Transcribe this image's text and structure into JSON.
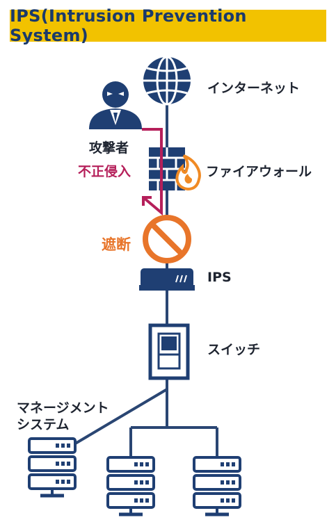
{
  "title": "IPS(Intrusion Prevention System)",
  "labels": {
    "internet": "インターネット",
    "attacker": "攻撃者",
    "intrusion": "不正侵入",
    "firewall": "ファイアウォール",
    "block": "遮断",
    "ips": "IPS",
    "switch": "スイッチ",
    "management_line1": "マネージメント",
    "management_line2": "システム"
  },
  "icons": [
    "globe-icon",
    "attacker-icon",
    "firewall-icon",
    "fire-icon",
    "block-icon",
    "ips-device-icon",
    "switch-icon",
    "server-icon"
  ],
  "colors": {
    "title_bg": "#f2c200",
    "title_text": "#1a3a6b",
    "navy": "#1f3f73",
    "line": "#2a4673",
    "intrusion": "#b51f5a",
    "block": "#e8752a",
    "fire": "#f08a24"
  }
}
